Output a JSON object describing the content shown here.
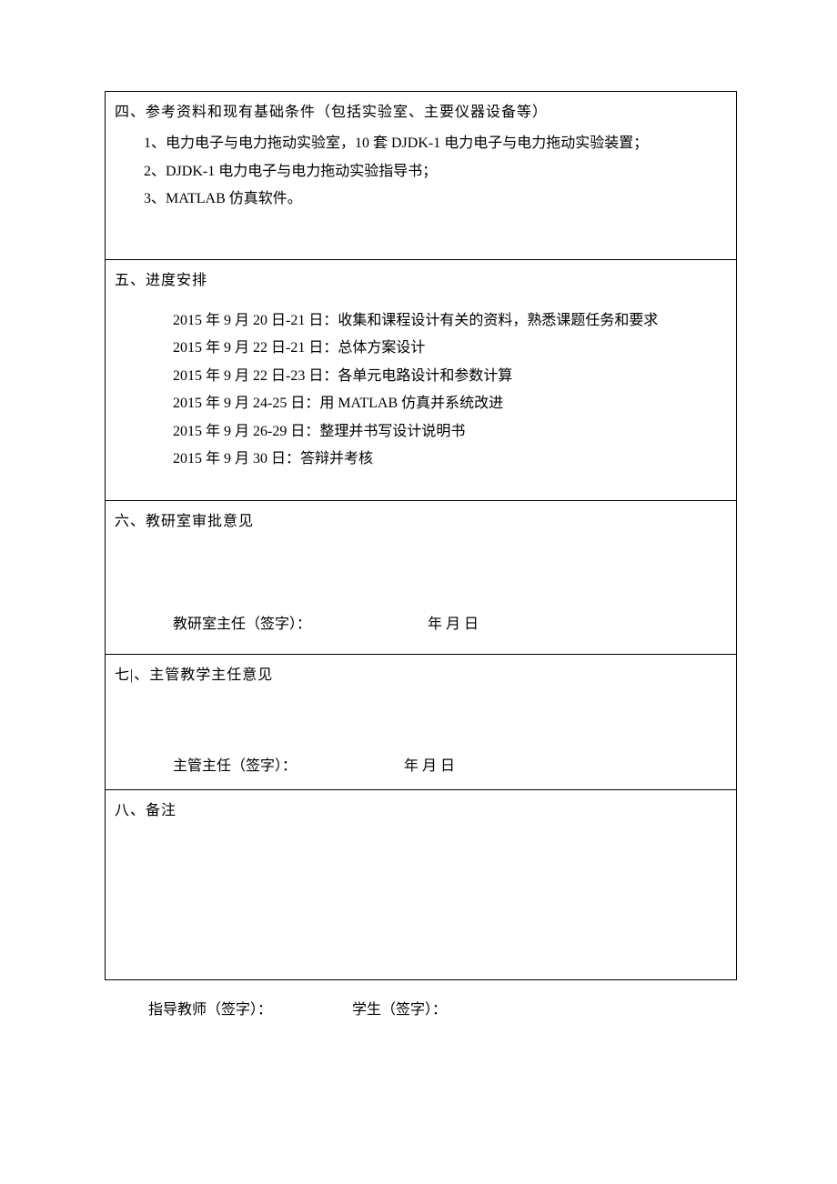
{
  "section4": {
    "heading": "四、参考资料和现有基础条件（包括实验室、主要仪器设备等）",
    "items": [
      "1、电力电子与电力拖动实验室，10 套 DJDK-1 电力电子与电力拖动实验装置；",
      "2、DJDK-1 电力电子与电力拖动实验指导书；",
      "3、MATLAB 仿真软件。"
    ]
  },
  "section5": {
    "heading": "五、进度安排",
    "items": [
      "2015 年 9 月 20 日-21 日：收集和课程设计有关的资料，熟悉课题任务和要求",
      "2015 年 9 月 22 日-21 日：总体方案设计",
      "2015 年 9 月 22 日-23 日：各单元电路设计和参数计算",
      "2015 年 9 月 24-25 日：用 MATLAB 仿真并系统改进",
      "2015 年 9 月 26-29 日：整理并书写设计说明书",
      "2015 年 9 月 30 日：答辩并考核"
    ]
  },
  "section6": {
    "heading": "六、教研室审批意见",
    "sig_label": "教研室主任（签字）：",
    "date_label": "年   月   日"
  },
  "section7": {
    "heading": "七|、主管教学主任意见",
    "sig_label": "主管主任（签字）：",
    "date_label": "年   月   日"
  },
  "section8": {
    "heading": "八、备注"
  },
  "footer": {
    "teacher_label": "指导教师（签字）：",
    "student_label": "学生（签字）："
  }
}
